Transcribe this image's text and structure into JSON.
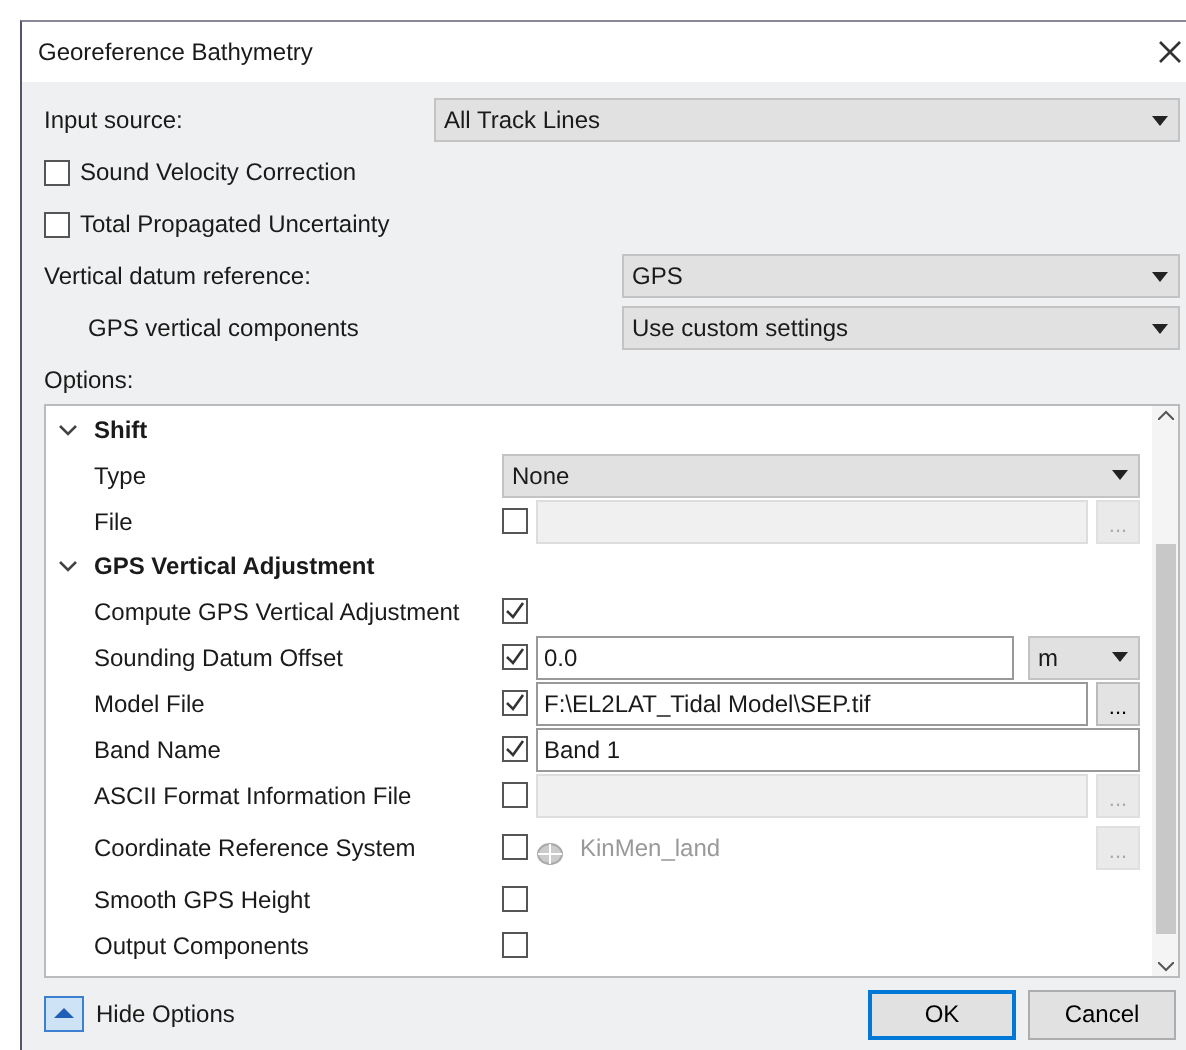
{
  "window": {
    "title": "Georeference Bathymetry"
  },
  "input_source": {
    "label": "Input source:",
    "value": "All Track Lines"
  },
  "checkboxes": [
    {
      "label": "Sound Velocity Correction",
      "checked": false
    },
    {
      "label": "Total Propagated Uncertainty",
      "checked": false
    }
  ],
  "vertical_datum": {
    "label": "Vertical datum reference:",
    "value": "GPS"
  },
  "gps_vertical_components": {
    "label": "GPS vertical components",
    "value": "Use custom settings"
  },
  "options": {
    "label": "Options:",
    "groups": [
      {
        "title": "Shift",
        "expanded": true,
        "children": [
          {
            "kind": "select",
            "label": "Type",
            "value": "None"
          },
          {
            "kind": "file",
            "label": "File",
            "checked": false,
            "button": "..."
          }
        ]
      },
      {
        "title": "GPS Vertical Adjustment",
        "expanded": true,
        "children": [
          {
            "kind": "check",
            "label": "Compute GPS Vertical Adjustment",
            "checked": true
          },
          {
            "kind": "number",
            "label": "Sounding Datum Offset",
            "checked": true,
            "value": "0.0",
            "unit": "m"
          },
          {
            "kind": "file",
            "label": "Model File",
            "checked": true,
            "value": "F:\\EL2LAT_Tidal Model\\SEP.tif",
            "button": "..."
          },
          {
            "kind": "text",
            "label": "Band Name",
            "checked": true,
            "value": "Band 1"
          },
          {
            "kind": "file",
            "label": "ASCII Format Information File",
            "checked": false,
            "button": "..."
          },
          {
            "kind": "crs",
            "label": "Coordinate Reference System",
            "checked": false,
            "value": "KinMen_land",
            "button": "..."
          },
          {
            "kind": "check",
            "label": "Smooth GPS Height",
            "checked": false
          },
          {
            "kind": "check",
            "label": "Output Components",
            "checked": false
          }
        ]
      }
    ]
  },
  "footer": {
    "toggle": "Hide Options",
    "buttons": [
      {
        "label": "OK",
        "default": true
      },
      {
        "label": "Cancel",
        "default": false
      }
    ]
  }
}
